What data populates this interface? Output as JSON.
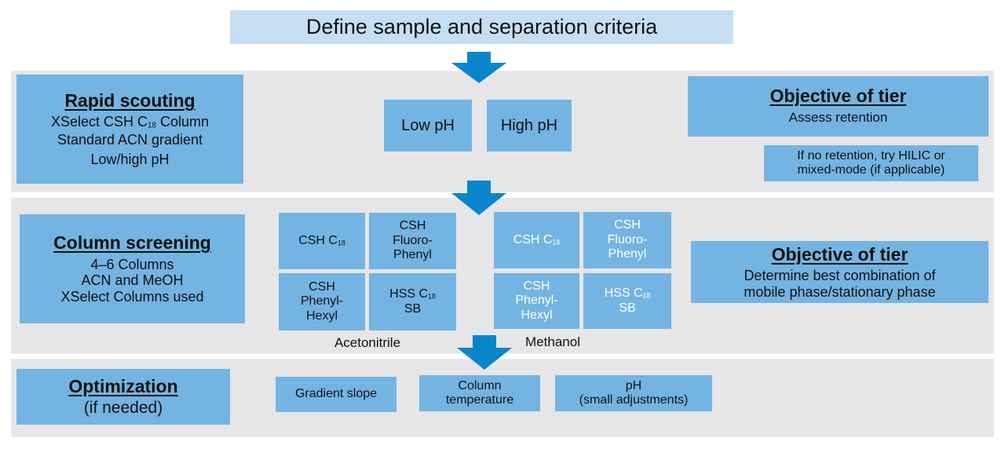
{
  "title": "Define sample and separation criteria",
  "colors": {
    "box_fill": "#74b4e2",
    "title_fill": "#c6def2",
    "band_fill": "#e6e6e8",
    "arrow_fill": "#0a85cc"
  },
  "tiers": [
    {
      "name": "Rapid scouting",
      "details": [
        {
          "pre": "XSelect CSH C",
          "sub": "18",
          "post": " Column"
        },
        {
          "text": "Standard ACN gradient"
        },
        {
          "text": "Low/high pH"
        }
      ],
      "options": [
        "Low pH",
        "High pH"
      ],
      "objective": {
        "heading": "Objective of tier",
        "text": "Assess retention",
        "note_lines": [
          "If no retention, try HILIC or",
          "mixed-mode (if applicable)"
        ]
      }
    },
    {
      "name": "Column screening",
      "details": [
        {
          "text": "4–6 Columns"
        },
        {
          "text": "ACN and MeOH"
        },
        {
          "text": "XSelect Columns used"
        }
      ],
      "groups": [
        {
          "label": "Acetonitrile",
          "columns": [
            {
              "lines": [
                {
                  "pre": "CSH C",
                  "sub": "18"
                }
              ]
            },
            {
              "lines": [
                {
                  "text": "CSH"
                },
                {
                  "text": "Fluoro-"
                },
                {
                  "text": "Phenyl"
                }
              ]
            },
            {
              "lines": [
                {
                  "text": "CSH"
                },
                {
                  "text": "Phenyl-"
                },
                {
                  "text": "Hexyl"
                }
              ]
            },
            {
              "lines": [
                {
                  "pre": "HSS C",
                  "sub": "18"
                },
                {
                  "text": "SB"
                }
              ]
            }
          ]
        },
        {
          "label": "Methanol",
          "columns": [
            {
              "lines": [
                {
                  "pre": "CSH C",
                  "sub": "18"
                }
              ]
            },
            {
              "lines": [
                {
                  "text": "CSH"
                },
                {
                  "text": "Fluoro-"
                },
                {
                  "text": "Phenyl"
                }
              ]
            },
            {
              "lines": [
                {
                  "text": "CSH"
                },
                {
                  "text": "Phenyl-"
                },
                {
                  "text": "Hexyl"
                }
              ]
            },
            {
              "lines": [
                {
                  "pre": "HSS C",
                  "sub": "18"
                },
                {
                  "text": "SB"
                }
              ]
            }
          ]
        }
      ],
      "objective": {
        "heading": "Objective of tier",
        "lines": [
          "Determine best combination of",
          "mobile phase/stationary phase"
        ]
      }
    },
    {
      "name": "Optimization",
      "subtitle": "(if needed)",
      "parameters": [
        {
          "lines": [
            "Gradient slope"
          ]
        },
        {
          "lines": [
            "Column",
            "temperature"
          ]
        },
        {
          "lines": [
            "pH",
            "(small adjustments)"
          ]
        }
      ]
    }
  ]
}
